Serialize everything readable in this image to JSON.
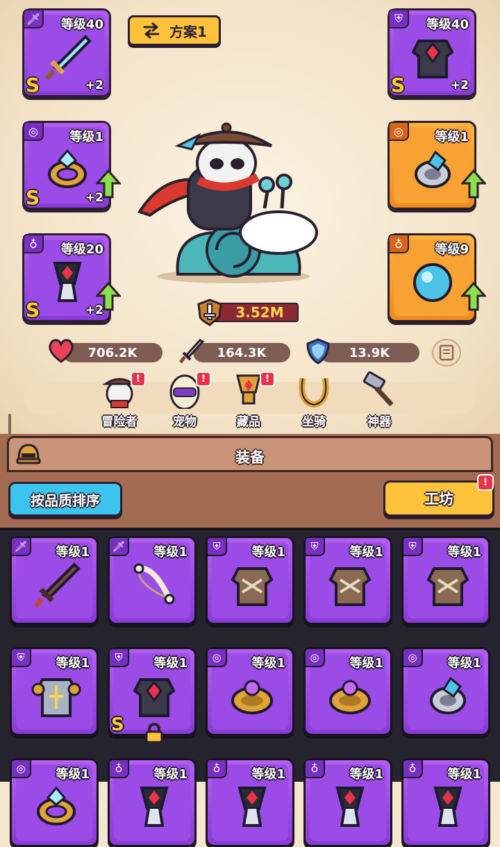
{
  "plan": {
    "label": "方案1"
  },
  "left_slots": [
    {
      "level": "等级40",
      "plus": "+2",
      "rank": "S",
      "tag": "🗡",
      "frame": "purple",
      "upgrade": false,
      "item": "sword"
    },
    {
      "level": "等级1",
      "plus": "+2",
      "rank": "S",
      "tag": "◎",
      "frame": "purple",
      "upgrade": true,
      "item": "ring"
    },
    {
      "level": "等级20",
      "plus": "+2",
      "rank": "S",
      "tag": "♁",
      "frame": "purple",
      "upgrade": true,
      "item": "amulet"
    }
  ],
  "right_slots": [
    {
      "level": "等级40",
      "plus": "+2",
      "rank": "S",
      "tag": "⛨",
      "frame": "purple",
      "upgrade": false,
      "item": "armor"
    },
    {
      "level": "等级1",
      "plus": "",
      "rank": "",
      "tag": "◎",
      "frame": "orange",
      "upgrade": true,
      "item": "ring-blue"
    },
    {
      "level": "等级9",
      "plus": "",
      "rank": "",
      "tag": "♁",
      "frame": "orange",
      "upgrade": true,
      "item": "orb"
    }
  ],
  "power": {
    "value": "3.52M"
  },
  "stats": {
    "hp": "706.2K",
    "attack": "164.3K",
    "defense": "13.9K"
  },
  "nav": [
    {
      "label": "冒险者",
      "alert": "!"
    },
    {
      "label": "宠物",
      "alert": "!"
    },
    {
      "label": "藏品",
      "alert": "!"
    },
    {
      "label": "坐骑",
      "alert": ""
    },
    {
      "label": "神器",
      "alert": ""
    }
  ],
  "panel": {
    "title": "装备",
    "sort_label": "按品质排序",
    "workshop_label": "工坊",
    "workshop_alert": "!"
  },
  "inventory": [
    {
      "level": "等级1",
      "tag": "🗡",
      "item": "wood-sword",
      "rank": "",
      "locked": false
    },
    {
      "level": "等级1",
      "tag": "🗡",
      "item": "bone-bow",
      "rank": "",
      "locked": false
    },
    {
      "level": "等级1",
      "tag": "⛨",
      "item": "fur-armor",
      "rank": "",
      "locked": false
    },
    {
      "level": "等级1",
      "tag": "⛨",
      "item": "fur-armor",
      "rank": "",
      "locked": false
    },
    {
      "level": "等级1",
      "tag": "⛨",
      "item": "fur-armor",
      "rank": "",
      "locked": false
    },
    {
      "level": "等级1",
      "tag": "⛨",
      "item": "steel-armor",
      "rank": "",
      "locked": false
    },
    {
      "level": "等级1",
      "tag": "⛨",
      "item": "armor",
      "rank": "S",
      "locked": true
    },
    {
      "level": "等级1",
      "tag": "◎",
      "item": "gold-ring",
      "rank": "",
      "locked": false
    },
    {
      "level": "等级1",
      "tag": "◎",
      "item": "gold-ring",
      "rank": "",
      "locked": false
    },
    {
      "level": "等级1",
      "tag": "◎",
      "item": "ring-blue",
      "rank": "",
      "locked": false
    },
    {
      "level": "等级1",
      "tag": "◎",
      "item": "ring",
      "rank": "",
      "locked": false
    },
    {
      "level": "等级1",
      "tag": "♁",
      "item": "amulet",
      "rank": "",
      "locked": false
    },
    {
      "level": "等级1",
      "tag": "♁",
      "item": "amulet",
      "rank": "",
      "locked": false
    },
    {
      "level": "等级1",
      "tag": "♁",
      "item": "amulet",
      "rank": "",
      "locked": false
    },
    {
      "level": "等级1",
      "tag": "♁",
      "item": "amulet",
      "rank": "",
      "locked": false
    }
  ],
  "colors": {
    "epic": "#9c4ce6",
    "legendary": "#f7a233",
    "accent": "#ffc23a",
    "sort": "#3cc4ee",
    "alert": "#e8334a"
  }
}
